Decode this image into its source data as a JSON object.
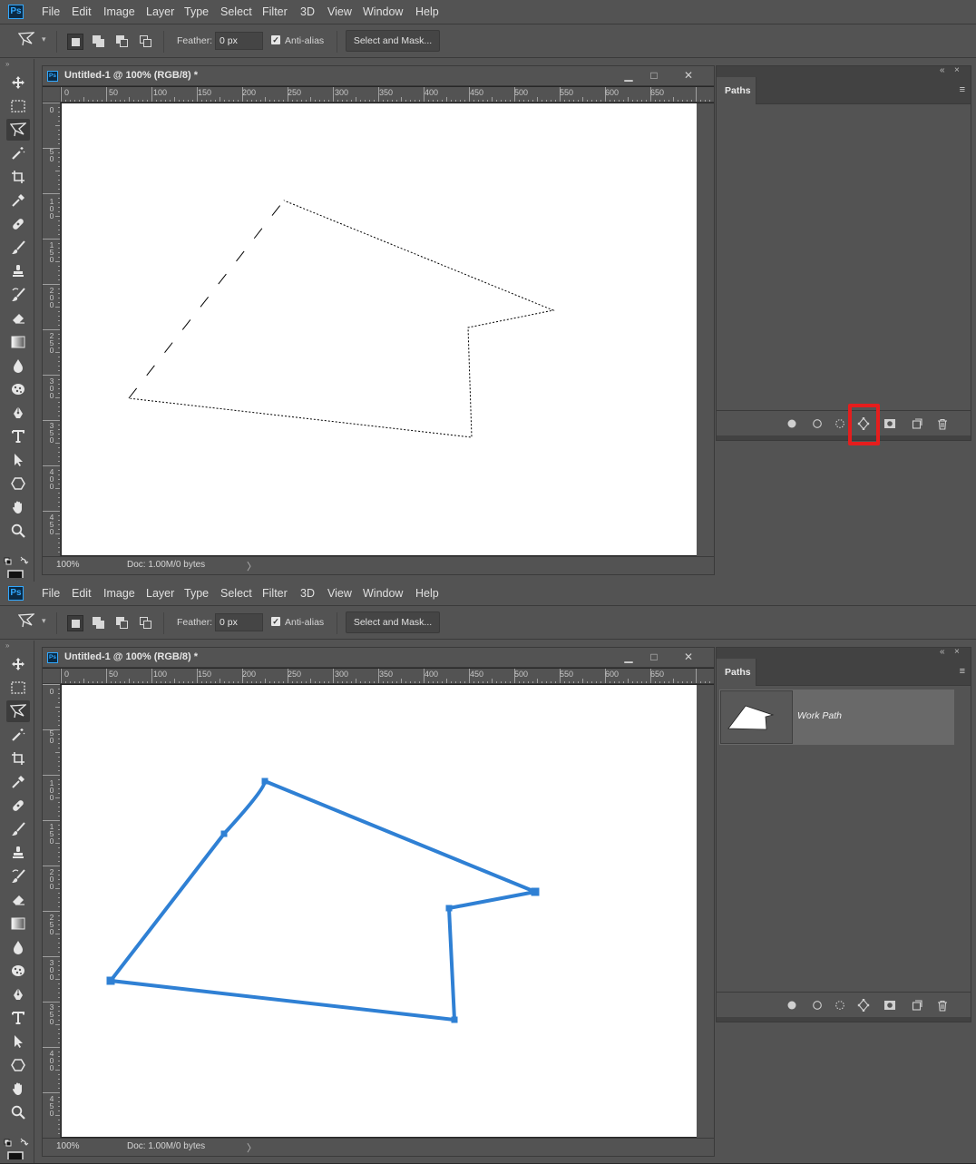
{
  "menu": {
    "logo": "Ps",
    "items": [
      "File",
      "Edit",
      "Image",
      "Layer",
      "Type",
      "Select",
      "Filter",
      "3D",
      "View",
      "Window",
      "Help"
    ]
  },
  "options": {
    "feather_label": "Feather:",
    "feather_value": "0 px",
    "antialias_label": "Anti-alias",
    "antialias_checked": true,
    "select_mask_label": "Select and Mask..."
  },
  "toolbar": {
    "tools": [
      "move-icon",
      "marquee-icon",
      "polygonal-lasso-icon",
      "magic-wand-icon",
      "crop-icon",
      "eyedropper-icon",
      "healing-brush-icon",
      "brush-icon",
      "clone-stamp-icon",
      "history-brush-icon",
      "eraser-icon",
      "gradient-icon",
      "blur-icon",
      "sponge-icon",
      "pen-icon",
      "type-icon",
      "path-selection-icon",
      "shape-icon",
      "hand-icon",
      "zoom-icon"
    ],
    "selected_tool": "polygonal-lasso-icon"
  },
  "document": {
    "title": "Untitled-1 @ 100% (RGB/8) *",
    "zoom": "100%",
    "doc_info": "Doc: 1.00M/0 bytes",
    "ruler_h": [
      "0",
      "50",
      "100",
      "150",
      "200",
      "250",
      "300",
      "350",
      "400",
      "450",
      "500",
      "550",
      "600",
      "650"
    ],
    "ruler_v": [
      "0",
      "50",
      "100",
      "150",
      "200",
      "250",
      "300",
      "350",
      "400",
      "450"
    ]
  },
  "paths_panel": {
    "tab_label": "Paths",
    "work_path_label": "Work Path",
    "buttons": [
      "fill-path-icon",
      "stroke-path-icon",
      "load-selection-icon",
      "make-work-path-icon",
      "add-mask-icon",
      "new-path-icon",
      "delete-path-icon"
    ]
  },
  "states": [
    {
      "id": "before",
      "shows_work_path": false,
      "highlighted_button": "make-work-path-icon"
    },
    {
      "id": "after",
      "shows_work_path": true,
      "highlighted_button": ""
    }
  ],
  "colors": {
    "ui_bg": "#535353",
    "dark_bg": "#282828",
    "path_stroke": "#2f80d4",
    "highlight": "#e51d1d"
  }
}
